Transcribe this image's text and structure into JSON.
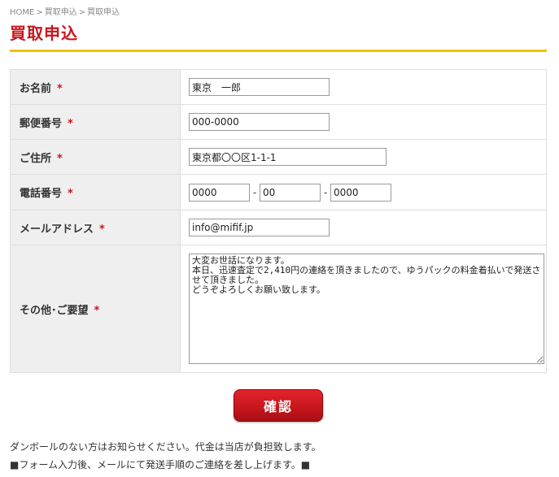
{
  "breadcrumb": {
    "home": "HOME",
    "separator": ">",
    "parent": "買取申込",
    "current": "買取申込"
  },
  "page_title": "買取申込",
  "required_mark": "*",
  "form": {
    "name": {
      "label": "お名前",
      "value": "東京　一郎"
    },
    "postal": {
      "label": "郵便番号",
      "value": "000-0000"
    },
    "address": {
      "label": "ご住所",
      "value": "東京都〇〇区1-1-1"
    },
    "phone": {
      "label": "電話番号",
      "part1": "0000",
      "part2": "00",
      "part3": "0000",
      "separator": "-"
    },
    "email": {
      "label": "メールアドレス",
      "value": "info@mifif.jp"
    },
    "request": {
      "label": "その他･ご要望",
      "value": "大変お世話になります。\n本日、迅速査定で2,410円の連絡を頂きましたので、ゆうパックの料金着払いで発送させて頂きました。\nどうぞよろしくお願い致します。"
    }
  },
  "confirm_button": "確認",
  "notes": {
    "line1": "ダンボールのない方はお知らせください。代金は当店が負担致します。",
    "line2": "■フォーム入力後、メールにて発送手順のご連絡を差し上げます。■"
  },
  "colors": {
    "accent_red": "#c8161d",
    "rule_yellow": "#f2c200",
    "label_bg": "#efefef"
  }
}
